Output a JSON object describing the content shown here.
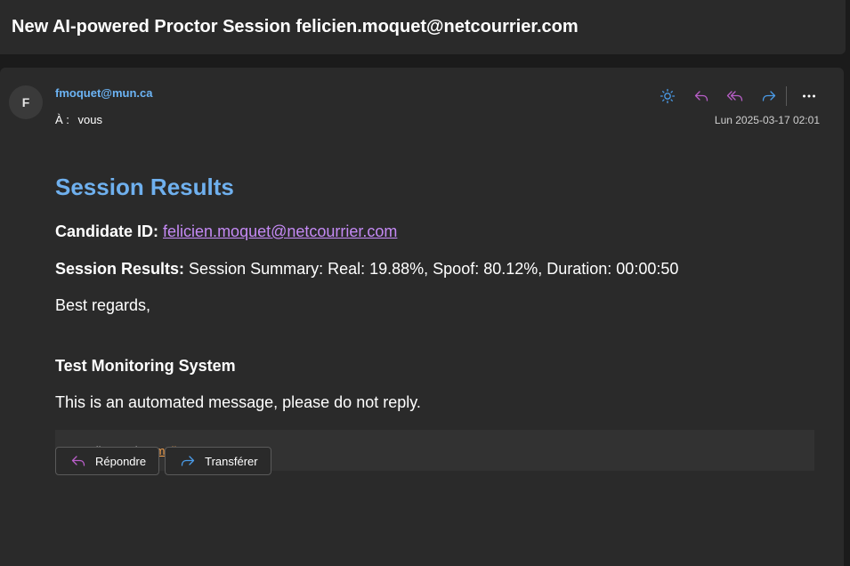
{
  "subject": "New AI-powered Proctor Session felicien.moquet@netcourrier.com",
  "sender": {
    "initial": "F",
    "email": "fmoquet@mun.ca"
  },
  "recipient": {
    "label": "À :",
    "value": "vous"
  },
  "date": "Lun 2025-03-17 02:01",
  "toolbar": {
    "icons": [
      "sun-icon",
      "reply-icon",
      "reply-all-icon",
      "forward-icon",
      "more-icon"
    ],
    "colors": {
      "sun": "#4a9be8",
      "reply": "#b85ec8",
      "reply_all": "#b85ec8",
      "forward": "#4a9be8"
    }
  },
  "body": {
    "heading": "Session Results",
    "candidate_label": "Candidate ID:",
    "candidate_value": "felicien.moquet@netcourrier.com",
    "results_label": "Session Results:",
    "results_value": " Session Summary: Real: 19.88%, Spoof: 80.12%, Duration: 00:00:50",
    "closing": "Best regards,",
    "signature": "Test Monitoring System",
    "notice": "This is an automated message, please do not reply.",
    "footer_prefix": "Email sent via",
    "footer_link": "EmailJS.com"
  },
  "buttons": {
    "reply": "Répondre",
    "forward": "Transférer"
  },
  "colors": {
    "heading": "#6fb0ee",
    "link": "#c58af5",
    "footer_link": "#f5a04a",
    "sender": "#6cb4f5"
  }
}
